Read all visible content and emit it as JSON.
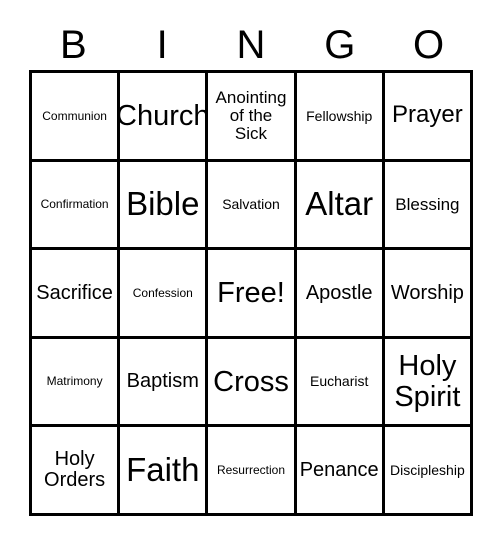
{
  "card": {
    "type": "bingo-card",
    "title_letters": [
      "B",
      "I",
      "N",
      "G",
      "O"
    ],
    "background_color": "#ffffff",
    "border_color": "#000000",
    "text_color": "#000000",
    "columns": 5,
    "rows": 5,
    "free_space": "Free!",
    "cells": [
      [
        {
          "label": "Communion",
          "size": "xs"
        },
        {
          "label": "Church",
          "size": "xxl"
        },
        {
          "label": "Anointing\nof the\nSick",
          "size": "m"
        },
        {
          "label": "Fellowship",
          "size": "s"
        },
        {
          "label": "Prayer",
          "size": "xl"
        }
      ],
      [
        {
          "label": "Confirmation",
          "size": "xs"
        },
        {
          "label": "Bible",
          "size": "3xl"
        },
        {
          "label": "Salvation",
          "size": "s"
        },
        {
          "label": "Altar",
          "size": "3xl"
        },
        {
          "label": "Blessing",
          "size": "m"
        }
      ],
      [
        {
          "label": "Sacrifice",
          "size": "l"
        },
        {
          "label": "Confession",
          "size": "xs"
        },
        {
          "label": "Free!",
          "size": "xxl"
        },
        {
          "label": "Apostle",
          "size": "l"
        },
        {
          "label": "Worship",
          "size": "l"
        }
      ],
      [
        {
          "label": "Matrimony",
          "size": "xs"
        },
        {
          "label": "Baptism",
          "size": "l"
        },
        {
          "label": "Cross",
          "size": "xxl"
        },
        {
          "label": "Eucharist",
          "size": "s"
        },
        {
          "label": "Holy\nSpirit",
          "size": "xxl"
        }
      ],
      [
        {
          "label": "Holy\nOrders",
          "size": "l"
        },
        {
          "label": "Faith",
          "size": "3xl"
        },
        {
          "label": "Resurrection",
          "size": "xs"
        },
        {
          "label": "Penance",
          "size": "l"
        },
        {
          "label": "Discipleship",
          "size": "s"
        }
      ]
    ]
  }
}
